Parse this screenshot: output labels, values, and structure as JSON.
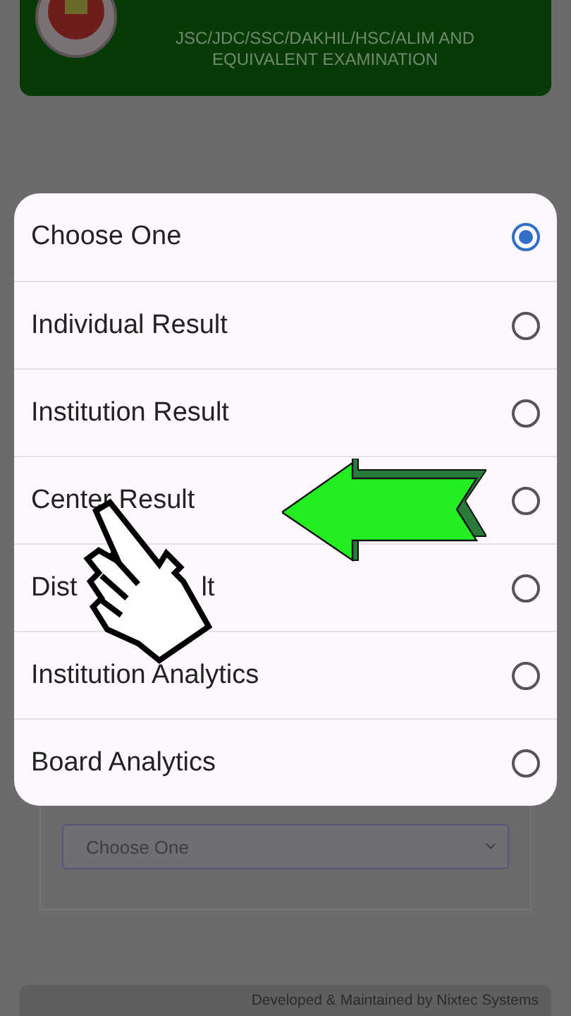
{
  "header": {
    "title": "JSC/JDC/SSC/DAKHIL/HSC/ALIM AND EQUIVALENT EXAMINATION"
  },
  "dialog": {
    "options": [
      {
        "label": "Choose One",
        "selected": true
      },
      {
        "label": "Individual Result",
        "selected": false
      },
      {
        "label": "Institution Result",
        "selected": false
      },
      {
        "label": "Center Result",
        "selected": false
      },
      {
        "label": "Dist",
        "label_end": "lt",
        "selected": false
      },
      {
        "label": "Institution Analytics",
        "selected": false
      },
      {
        "label": "Board Analytics",
        "selected": false
      }
    ]
  },
  "form": {
    "select_value": "Choose One"
  },
  "footer": {
    "text": "Developed & Maintained by Nixtec Systems"
  }
}
